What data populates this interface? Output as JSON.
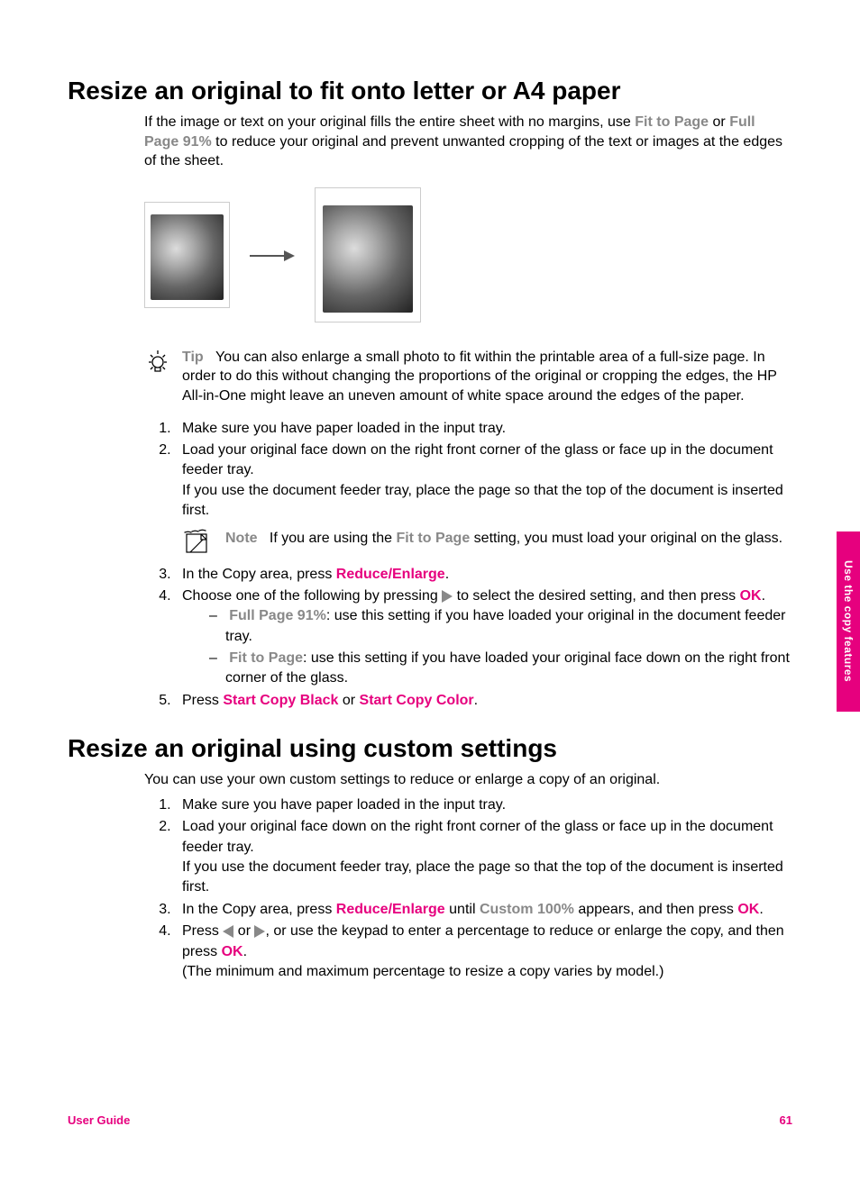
{
  "sideTab": "Use the copy features",
  "footer": {
    "left": "User Guide",
    "right": "61"
  },
  "section1": {
    "heading": "Resize an original to fit onto letter or A4 paper",
    "intro": {
      "t1": "If the image or text on your original fills the entire sheet with no margins, use ",
      "fit": "Fit to Page",
      "t2": " or ",
      "full": "Full Page 91%",
      "t3": " to reduce your original and prevent unwanted cropping of the text or images at the edges of the sheet."
    },
    "tip": {
      "label": "Tip",
      "body": "You can also enlarge a small photo to fit within the printable area of a full-size page. In order to do this without changing the proportions of the original or cropping the edges, the HP All-in-One might leave an uneven amount of white space around the edges of the paper."
    },
    "step1": "Make sure you have paper loaded in the input tray.",
    "step2a": "Load your original face down on the right front corner of the glass or face up in the document feeder tray.",
    "step2b": "If you use the document feeder tray, place the page so that the top of the document is inserted first.",
    "note": {
      "label": "Note",
      "t1": "If you are using the ",
      "fit": "Fit to Page",
      "t2": " setting, you must load your original on the glass."
    },
    "step3": {
      "t1": "In the Copy area, press ",
      "btn": "Reduce/Enlarge",
      "t2": "."
    },
    "step4": {
      "t1": "Choose one of the following by pressing ",
      "t2": " to select the desired setting, and then press ",
      "ok": "OK",
      "t3": ".",
      "bullet1": {
        "label": "Full Page 91%",
        "rest": ": use this setting if you have loaded your original in the document feeder tray."
      },
      "bullet2": {
        "label": "Fit to Page",
        "rest": ": use this setting if you have loaded your original face down on the right front corner of the glass."
      }
    },
    "step5": {
      "t1": "Press ",
      "b1": "Start Copy Black",
      "t2": " or ",
      "b2": "Start Copy Color",
      "t3": "."
    }
  },
  "section2": {
    "heading": "Resize an original using custom settings",
    "intro": "You can use your own custom settings to reduce or enlarge a copy of an original.",
    "step1": "Make sure you have paper loaded in the input tray.",
    "step2a": "Load your original face down on the right front corner of the glass or face up in the document feeder tray.",
    "step2b": "If you use the document feeder tray, place the page so that the top of the document is inserted first.",
    "step3": {
      "t1": "In the Copy area, press ",
      "btn": "Reduce/Enlarge",
      "t2": " until ",
      "custom": "Custom 100%",
      "t3": " appears, and then press ",
      "ok": "OK",
      "t4": "."
    },
    "step4": {
      "t1": "Press ",
      "t2": " or ",
      "t3": ", or use the keypad to enter a percentage to reduce or enlarge the copy, and then press ",
      "ok": "OK",
      "t4": ".",
      "paren": "(The minimum and maximum percentage to resize a copy varies by model.)"
    }
  }
}
